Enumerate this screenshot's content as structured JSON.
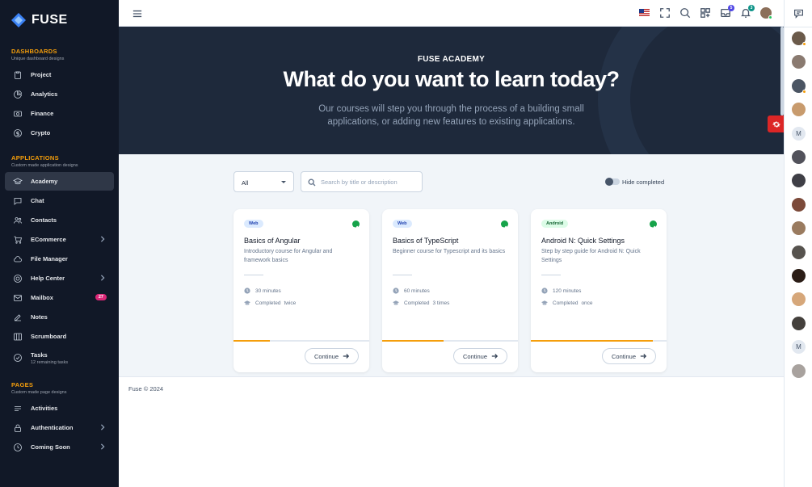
{
  "brand": {
    "name": "FUSE"
  },
  "sidebar": {
    "dashboards": {
      "title": "DASHBOARDS",
      "subtitle": "Unique dashboard designs",
      "items": [
        {
          "label": "Project",
          "icon": "clipboard-icon"
        },
        {
          "label": "Analytics",
          "icon": "chart-pie-icon"
        },
        {
          "label": "Finance",
          "icon": "cash-icon"
        },
        {
          "label": "Crypto",
          "icon": "currency-dollar-icon"
        }
      ]
    },
    "applications": {
      "title": "APPLICATIONS",
      "subtitle": "Custom made application designs",
      "items": [
        {
          "label": "Academy",
          "icon": "academic-cap-icon",
          "active": true
        },
        {
          "label": "Chat",
          "icon": "chat-bubble-icon"
        },
        {
          "label": "Contacts",
          "icon": "user-group-icon"
        },
        {
          "label": "ECommerce",
          "icon": "shopping-cart-icon",
          "has_children": true
        },
        {
          "label": "File Manager",
          "icon": "cloud-icon"
        },
        {
          "label": "Help Center",
          "icon": "support-icon",
          "has_children": true
        },
        {
          "label": "Mailbox",
          "icon": "mail-icon",
          "badge": "27"
        },
        {
          "label": "Notes",
          "icon": "pencil-square-icon"
        },
        {
          "label": "Scrumboard",
          "icon": "view-boards-icon"
        },
        {
          "label": "Tasks",
          "subtitle": "12 remaining tasks",
          "icon": "check-circle-icon"
        }
      ]
    },
    "pages": {
      "title": "PAGES",
      "subtitle": "Custom made page designs",
      "items": [
        {
          "label": "Activities",
          "icon": "menu-alt-icon"
        },
        {
          "label": "Authentication",
          "icon": "lock-icon",
          "has_children": true
        },
        {
          "label": "Coming Soon",
          "icon": "clock-icon",
          "has_children": true
        }
      ]
    }
  },
  "topbar": {
    "notifications_badge": "5",
    "messages_badge": "3",
    "colors": {
      "notifications": "#4f46e5",
      "messages": "#0d9488"
    }
  },
  "hero": {
    "kicker": "FUSE ACADEMY",
    "headline": "What do you want to learn today?",
    "description": "Our courses will step you through the process of a building small applications, or adding new features to existing applications."
  },
  "filters": {
    "category_value": "All",
    "search_placeholder": "Search by title or description",
    "hide_completed_label": "Hide completed"
  },
  "courses": [
    {
      "category": "Web",
      "title": "Basics of Angular",
      "description": "Introductory course for Angular and framework basics",
      "duration": "30 minutes",
      "completed_label": "Completed",
      "completed_value": "twice",
      "progress": 0.27,
      "button": "Continue"
    },
    {
      "category": "Web",
      "title": "Basics of TypeScript",
      "description": "Beginner course for Typescript and its basics",
      "duration": "60 minutes",
      "completed_label": "Completed",
      "completed_value": "3 times",
      "progress": 0.45,
      "button": "Continue"
    },
    {
      "category": "Android",
      "title": "Android N: Quick Settings",
      "description": "Step by step guide for Android N: Quick Settings",
      "duration": "120 minutes",
      "completed_label": "Completed",
      "completed_value": "once",
      "progress": 0.9,
      "button": "Continue"
    }
  ],
  "footer": {
    "text": "Fuse © 2024"
  },
  "rail": {
    "contacts": [
      {
        "type": "photo",
        "color": "#6b5a4a",
        "status": "#f59e0b"
      },
      {
        "type": "photo",
        "color": "#8a7a70",
        "status": ""
      },
      {
        "type": "photo",
        "color": "#4b5563",
        "status": "#f59e0b"
      },
      {
        "type": "photo",
        "color": "#c89b6d",
        "status": ""
      },
      {
        "type": "letter",
        "letter": "M"
      },
      {
        "type": "photo",
        "color": "#52525b",
        "status": ""
      },
      {
        "type": "photo",
        "color": "#3f3f46",
        "status": ""
      },
      {
        "type": "photo",
        "color": "#7c4a3a",
        "status": ""
      },
      {
        "type": "photo",
        "color": "#9a7b5f",
        "status": ""
      },
      {
        "type": "photo",
        "color": "#57534e",
        "status": ""
      },
      {
        "type": "photo",
        "color": "#2b1d16",
        "status": ""
      },
      {
        "type": "photo",
        "color": "#d6a77a",
        "status": ""
      },
      {
        "type": "photo",
        "color": "#44403c",
        "status": ""
      },
      {
        "type": "letter",
        "letter": "M"
      },
      {
        "type": "photo",
        "color": "#a8a29e",
        "status": ""
      }
    ]
  }
}
